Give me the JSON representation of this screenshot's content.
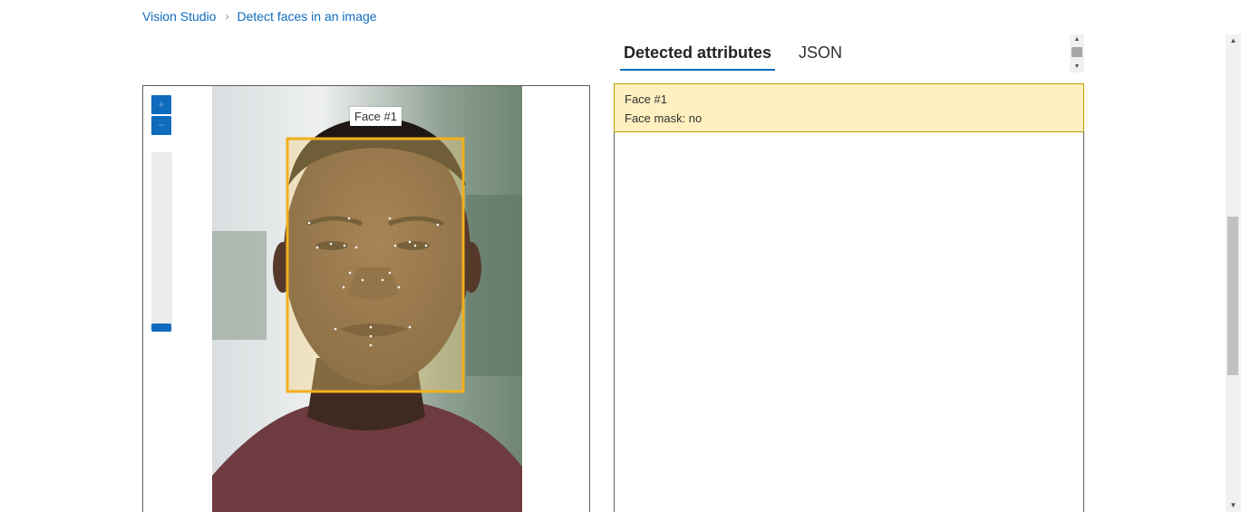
{
  "breadcrumb": {
    "root": "Vision Studio",
    "separator": "›",
    "current": "Detect faces in an image"
  },
  "viewer": {
    "zoom_in_label": "+",
    "zoom_out_label": "−",
    "face_tag": "Face #1"
  },
  "tabs": [
    {
      "label": "Detected attributes",
      "active": true
    },
    {
      "label": "JSON",
      "active": false
    }
  ],
  "results": [
    {
      "title": "Face #1",
      "detail": "Face mask: no"
    }
  ],
  "scrollbar": {
    "up_icon": "▲",
    "down_icon": "▼"
  },
  "colors": {
    "accent": "#0f6cbd",
    "face_box": "#f2b01e",
    "result_highlight": "#fff0c0"
  }
}
